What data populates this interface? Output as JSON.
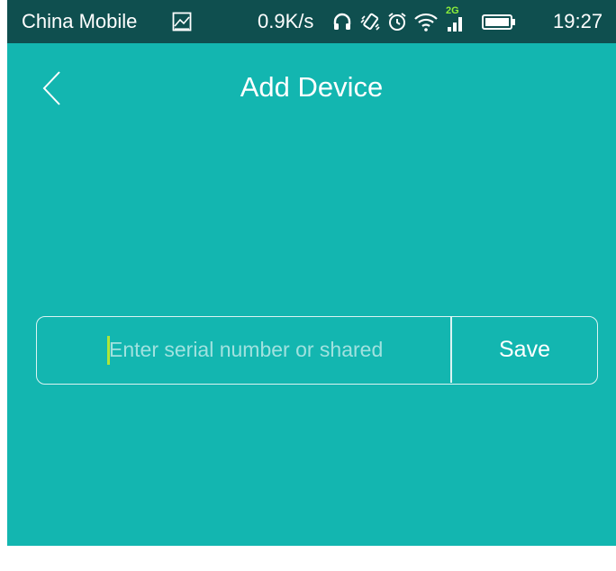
{
  "status_bar": {
    "carrier": "China Mobile",
    "net_speed": "0.9K/s",
    "signal_label": "2G",
    "time": "19:27",
    "icons": [
      "gallery-icon",
      "headphones-icon",
      "vibrate-icon",
      "alarm-icon",
      "wifi-icon",
      "signal-icon",
      "battery-icon"
    ]
  },
  "header": {
    "title": "Add Device",
    "back_icon": "chevron-left-icon"
  },
  "form": {
    "serial_value": "",
    "serial_placeholder": "Enter serial number or shared",
    "save_label": "Save"
  },
  "colors": {
    "background": "#13b6b0",
    "status_bar": "#0f4f4f",
    "caret": "#aee53a",
    "text": "#ffffff"
  }
}
